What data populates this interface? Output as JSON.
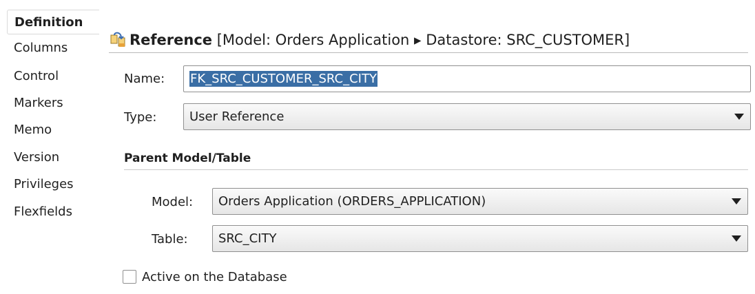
{
  "sidebar": {
    "items": [
      {
        "label": "Definition",
        "active": true
      },
      {
        "label": "Columns"
      },
      {
        "label": "Control"
      },
      {
        "label": "Markers"
      },
      {
        "label": "Memo"
      },
      {
        "label": "Version"
      },
      {
        "label": "Privileges"
      },
      {
        "label": "Flexfields"
      }
    ]
  },
  "header": {
    "icon": "reference-icon",
    "prefix": "Reference",
    "title_rest": " [Model: Orders Application ▸ Datastore: SRC_CUSTOMER]"
  },
  "form": {
    "name_label": "Name:",
    "name_value": "FK_SRC_CUSTOMER_SRC_CITY",
    "type_label": "Type:",
    "type_value": "User Reference",
    "parent_section": "Parent Model/Table",
    "model_label": "Model:",
    "model_value": "Orders Application (ORDERS_APPLICATION)",
    "table_label": "Table:",
    "table_value": "SRC_CITY",
    "active_label": "Active on the Database",
    "active_checked": false
  },
  "colors": {
    "selection": "#3a6ea5",
    "border": "#8f8f8f"
  }
}
